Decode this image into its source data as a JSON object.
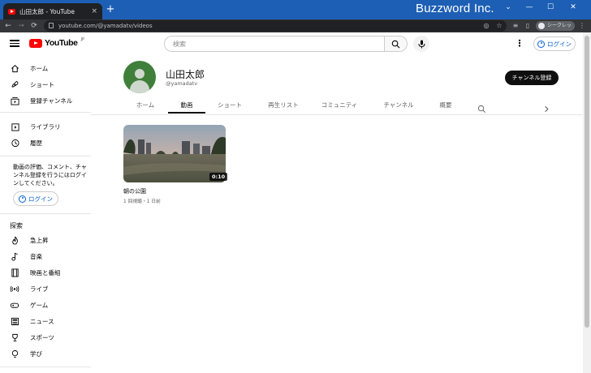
{
  "browser": {
    "tab_title": "山田太郎 - YouTube",
    "tab_close": "×",
    "new_tab": "+",
    "url": "youtube.com/@yamadatv/videos",
    "incognito_label": "シークレット",
    "watermark": "Buzzword Inc.",
    "window_controls": [
      "⌄",
      "—",
      "☐",
      "✕"
    ]
  },
  "masthead": {
    "logo_text": "YouTube",
    "logo_region": "JP",
    "search_placeholder": "検索",
    "more_glyph": "⋮",
    "login_label": "ログイン"
  },
  "sidebar": {
    "primary": [
      {
        "label": "ホーム",
        "icon": "home-icon"
      },
      {
        "label": "ショート",
        "icon": "shorts-icon"
      },
      {
        "label": "登録チャンネル",
        "icon": "subscriptions-icon"
      }
    ],
    "secondary": [
      {
        "label": "ライブラリ",
        "icon": "library-icon"
      },
      {
        "label": "履歴",
        "icon": "history-icon"
      }
    ],
    "signin_message": "動画の評価、コメント、チャンネル登録を行うにはログインしてください。",
    "login_label": "ログイン",
    "explore_title": "探索",
    "explore": [
      {
        "label": "急上昇",
        "icon": "trending-icon"
      },
      {
        "label": "音楽",
        "icon": "music-icon"
      },
      {
        "label": "映画と番組",
        "icon": "film-icon"
      },
      {
        "label": "ライブ",
        "icon": "live-icon"
      },
      {
        "label": "ゲーム",
        "icon": "gaming-icon"
      },
      {
        "label": "ニュース",
        "icon": "news-icon"
      },
      {
        "label": "スポーツ",
        "icon": "sports-icon"
      },
      {
        "label": "学び",
        "icon": "learning-icon"
      }
    ]
  },
  "channel": {
    "name": "山田太郎",
    "handle": "@yamadatv",
    "subscribe_label": "チャンネル登録",
    "tabs": [
      "ホーム",
      "動画",
      "ショート",
      "再生リスト",
      "コミュニティ",
      "チャンネル",
      "概要"
    ],
    "active_tab": "動画"
  },
  "videos": [
    {
      "title": "朝の公園",
      "duration": "0:10",
      "meta": "1 回視聴・1 日前"
    }
  ],
  "colors": {
    "titlebar": "#1d5fb4",
    "brand_red": "#ff0000",
    "link_blue": "#065fd4",
    "subscribe_bg": "#0f0f0f"
  }
}
